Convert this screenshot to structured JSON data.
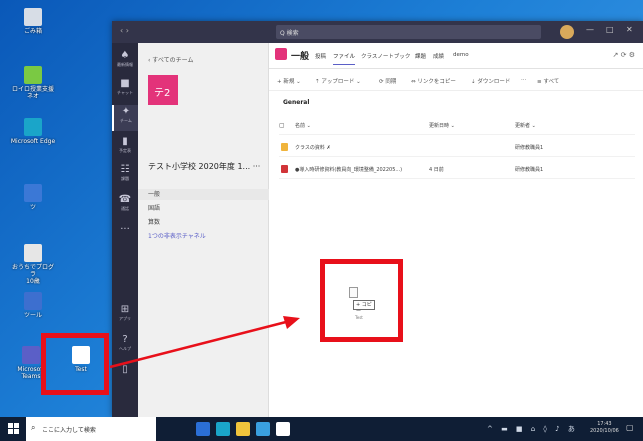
{
  "desktop": {
    "icons": [
      {
        "label": "ごみ箱",
        "color": "#d7dde6"
      },
      {
        "label": "ロイロ授業支援\nネオ",
        "color": "#7ac943"
      },
      {
        "label": "Microsoft Edge",
        "color": "#1aa5c9"
      },
      {
        "label": "ツ",
        "color": "#3b78d6"
      },
      {
        "label": "おうちでプログラ\n10歳",
        "color": "#e6e6e6"
      },
      {
        "label": "ツール",
        "color": "#3d6fcf"
      },
      {
        "label": "Microsoft Teams",
        "color": "#5b5fc7"
      },
      {
        "label": "Test",
        "color": "#ffffff"
      }
    ]
  },
  "teams": {
    "nav_arrows": "‹  ›",
    "search_placeholder": "Q 検索",
    "window_controls": [
      "—",
      "□",
      "✕"
    ],
    "rail": [
      {
        "glyph": "♠",
        "label": "最新情報"
      },
      {
        "glyph": "■",
        "label": "チャット"
      },
      {
        "glyph": "✦",
        "label": "チーム"
      },
      {
        "glyph": "▮",
        "label": "予定表"
      },
      {
        "glyph": "☷",
        "label": "課題"
      },
      {
        "glyph": "☎",
        "label": "通話"
      },
      {
        "glyph": "···",
        "label": ""
      },
      {
        "glyph": "⊞",
        "label": "アプリ"
      },
      {
        "glyph": "?",
        "label": "ヘルプ"
      },
      {
        "glyph": "▯",
        "label": ""
      }
    ],
    "team_panel": {
      "back_label": "‹ すべてのチーム",
      "tile_text": "テ2",
      "team_name": "テスト小学校 2020年度 1... ···",
      "channels": [
        "一般",
        "国語",
        "算数"
      ],
      "hidden_link": "1つの非表示チャネル"
    },
    "channel": {
      "name": "一般",
      "tabs": [
        "投稿",
        "ファイル",
        "クラスノートブック",
        "課題",
        "成績",
        "demo"
      ],
      "active_tab": "ファイル",
      "header_icons": "↗ ⟳ ⚙"
    },
    "toolbar": [
      "+ 新規 ⌄",
      "⇡ アップロード ⌄",
      "⟳ 同期",
      "⇔ リンクをコピー",
      "⇣ ダウンロード",
      "···",
      "≡ すべて"
    ],
    "breadcrumb": "General",
    "file_table": {
      "headers": [
        "名前 ⌄",
        "更新日時 ⌄",
        "更新者 ⌄"
      ],
      "rows": [
        {
          "icon_color": "#f0b43c",
          "name": "クラスの資料 ✗",
          "modified": "",
          "by": "研修教職員1"
        },
        {
          "icon_color": "#d13438",
          "name": "●導入時研修資料(教員向_環境整備_202205...)",
          "modified": "4 日前",
          "by": "研修教職員1"
        }
      ]
    },
    "drag": {
      "copy_label": "+ コピー",
      "file_name": "Test"
    }
  },
  "taskbar": {
    "search_text": "ここに入力して検索",
    "apps": [
      {
        "color": "#2b6fd6"
      },
      {
        "color": "#1aa5c9"
      },
      {
        "color": "#f0c43c"
      },
      {
        "color": "#3aa0e0"
      },
      {
        "color": "#ffffff"
      }
    ],
    "tray": "^ ▬ ■ ⌂ ◊ ♪ あ",
    "time": "17:43",
    "date": "2020/10/06",
    "notif": "▢"
  },
  "annotation": {
    "color": "#e8101a"
  }
}
